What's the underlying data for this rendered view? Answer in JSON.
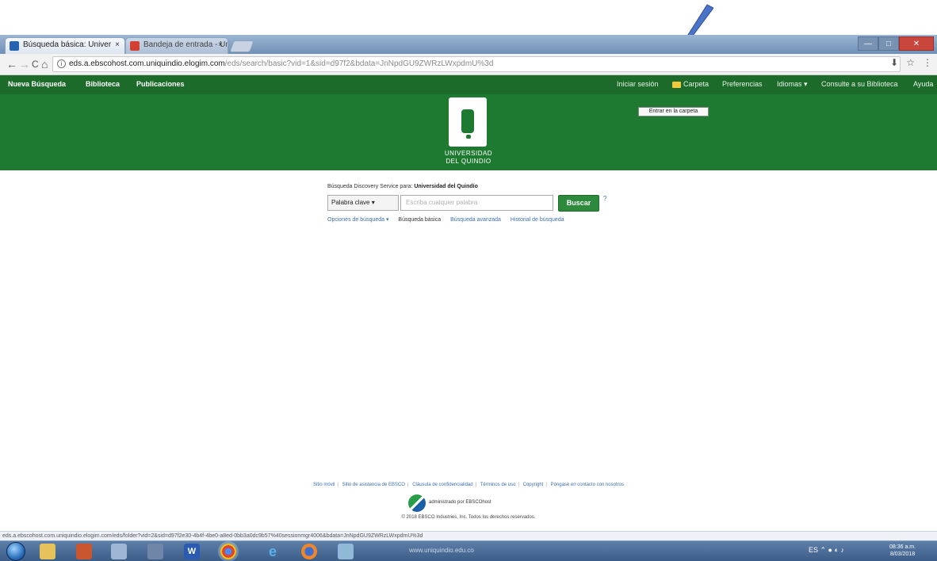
{
  "browser": {
    "tabs": [
      {
        "label": "Búsqueda básica: Univer",
        "close": "×"
      },
      {
        "label": "Bandeja de entrada - Univers",
        "close": "×"
      }
    ],
    "window_controls": {
      "minimize": "—",
      "maximize": "□",
      "close": "✕"
    },
    "nav": {
      "back": "←",
      "forward": "→",
      "reload": "C",
      "home": "⌂"
    },
    "url_host": "eds.a.ebscohost.com.uniquindio.elogim.com",
    "url_path": "/eds/search/basic?vid=1&sid=d97f2&bdata=JnNpdGU9ZWRzLWxpdmU%3d",
    "toolbar_icons": {
      "extension": "⬇",
      "star": "☆",
      "menu": "⋮"
    }
  },
  "ebsco": {
    "nav_left": [
      "Nueva Búsqueda",
      "Biblioteca",
      "Publicaciones"
    ],
    "nav_right": [
      "Iniciar sesión",
      "Carpeta",
      "Preferencias",
      "Idiomas ▾",
      "Consulte a su Biblioteca",
      "Ayuda"
    ],
    "tooltip": "Entrar en la carpeta",
    "logo_line1": "UNIVERSIDAD",
    "logo_line2": "DEL QUINDIO",
    "search_label": "Búsqueda Discovery Service para: ",
    "search_institution": "Universidad del Quindío",
    "field_select": "Palabra clave ▾",
    "search_placeholder": "Escriba cualquier palabra",
    "search_button": "Buscar",
    "help": "?",
    "links": [
      "Opciones de búsqueda ▾",
      "Búsqueda básica",
      "Búsqueda avanzada",
      "Historial de búsqueda"
    ]
  },
  "footer": {
    "links": [
      "Sitio móvil",
      "Sitio de asistencia de EBSCO",
      "Cláusula de confidencialidad",
      "Términos de uso",
      "Copyright",
      "Póngase en contacto con nosotros"
    ],
    "powered": "administrado por EBSCOhost",
    "copyright": "© 2018 EBSCO Industries, Inc. Todos los derechos reservados."
  },
  "statusbar": {
    "text": "eds.a.ebscohost.com.uniquindio.elogim.com/eds/folder?vid=2&sid=d97f2e30-4b4f-4be0-a8ed-0bb3a0dc9b57%40sessionmgr4006&bdata=JnNpdGU9ZWRzLWxpdmU%3d"
  },
  "taskbar": {
    "window_title": "www.uniquindio.edu.co",
    "tray_icons": "ES  ⌃  ●  ◐  ♪",
    "time": "08:36 a.m.",
    "date": "8/03/2018"
  },
  "colors": {
    "ebsco_green": "#1f7a31",
    "ebsco_green_dark": "#1c6b2a",
    "button_green": "#2d8a3d",
    "link_blue": "#3b6fb5",
    "annotation_arrow": "#4a74c9"
  }
}
